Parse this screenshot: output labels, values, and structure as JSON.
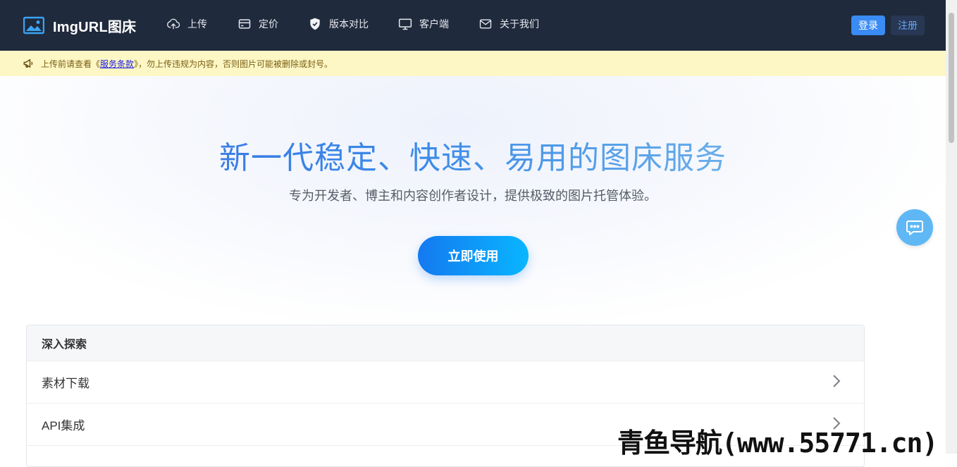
{
  "navbar": {
    "brand": "ImgURL图床",
    "items": [
      {
        "label": "上传",
        "icon": "cloud-upload-icon"
      },
      {
        "label": "定价",
        "icon": "credit-card-icon"
      },
      {
        "label": "版本对比",
        "icon": "shield-check-icon"
      },
      {
        "label": "客户端",
        "icon": "monitor-icon"
      },
      {
        "label": "关于我们",
        "icon": "mail-icon"
      }
    ],
    "login": "登录",
    "register": "注册"
  },
  "notice": {
    "before": "上传前请查看《",
    "link": "服务条款",
    "after": "》，勿上传违规为内容，否则图片可能被删除或封号。"
  },
  "hero": {
    "title": "新一代稳定、快速、易用的图床服务",
    "subtitle": "专为开发者、博主和内容创作者设计，提供极致的图片托管体验。",
    "cta": "立即使用"
  },
  "explore": {
    "title": "深入探索",
    "items": [
      "素材下载",
      "API集成"
    ]
  },
  "watermark": "青鱼导航(www.55771.cn)",
  "colors": {
    "navbar_bg": "#1f2a3c",
    "notice_bg": "#fdf6c5",
    "accent": "#3a8bf3",
    "cta_start": "#1479f0",
    "cta_end": "#09b6ff"
  }
}
